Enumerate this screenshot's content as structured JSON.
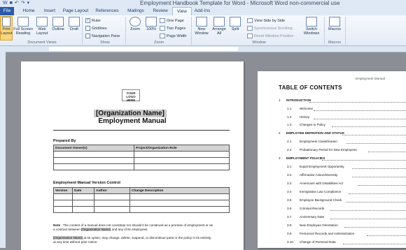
{
  "window": {
    "title": "Employment Handbook Template for Word  -  Microsoft Word non-commercial use"
  },
  "tabs": [
    "File",
    "Home",
    "Insert",
    "Page Layout",
    "References",
    "Mailings",
    "Review",
    "View",
    "Add-Ins"
  ],
  "ribbon": {
    "document_views": {
      "group_label": "Document Views",
      "buttons": [
        "Print Layout",
        "Full Screen Reading",
        "Web Layout",
        "Outline",
        "Draft"
      ]
    },
    "show": {
      "group_label": "Show",
      "ruler": "Ruler",
      "gridlines": "Gridlines",
      "navigation_pane": "Navigation Pane"
    },
    "zoom": {
      "group_label": "Zoom",
      "zoom": "Zoom",
      "hundred": "100%",
      "one_page": "One Page",
      "two_pages": "Two Pages",
      "page_width": "Page Width"
    },
    "window": {
      "group_label": "Window",
      "new_window": "New Window",
      "arrange_all": "Arrange All",
      "split": "Split",
      "view_side_by_side": "View Side by Side",
      "sync_scrolling": "Synchronous Scrolling",
      "reset_window_position": "Reset Window Position",
      "switch_windows": "Switch Windows"
    },
    "macros": {
      "group_label": "Macros",
      "macros": "Macros"
    }
  },
  "page1": {
    "logo": "YOUR LOGO HERE",
    "org_name": "[Organization Name]",
    "title": "Employment  Manual",
    "prepared_by": "Prepared By",
    "owners_table": {
      "headers": [
        "Document Owner(s)",
        "Project/Organization Role"
      ]
    },
    "version_control": "Employment Manual Version Control",
    "version_table": {
      "headers": [
        "Version",
        "Date",
        "Author",
        "Change Description"
      ]
    },
    "note_label": "Note",
    "note_text": "The content of a manual does not constitute nor should it be construed as a promise of employment or as a contract between",
    "note_org": "[Organization Name]",
    "note_tail": "and any of its employees.",
    "note2_org": "[Organization Name]",
    "note2_text": "at its option, may change, delete, suspend, or discontinue parts or the policy in its entirety, at any time without prior notice."
  },
  "page2": {
    "running_head": "Employment Manual",
    "toc_title": "TABLE OF CONTENTS",
    "entries": [
      {
        "num": "1",
        "text": "INTRODUCTION",
        "level": 1
      },
      {
        "num": "1.1",
        "text": "Welcome",
        "level": 2
      },
      {
        "num": "1.2",
        "text": "History",
        "level": 2
      },
      {
        "num": "1.3",
        "text": "Changes in Policy",
        "level": 2
      },
      {
        "num": "2",
        "text": "EMPLOYEE DEFINITION AND STATUS",
        "level": 1
      },
      {
        "num": "2.1",
        "text": "Employment Classification",
        "level": 2
      },
      {
        "num": "2.2",
        "text": "Probationary Period for New Employees",
        "level": 2
      },
      {
        "num": "3",
        "text": "EMPLOYMENT POLICIES",
        "level": 1
      },
      {
        "num": "3.1",
        "text": "Equal Employment Opportunity",
        "level": 2
      },
      {
        "num": "3.2",
        "text": "Affirmative Action/Diversity",
        "level": 2
      },
      {
        "num": "3.3",
        "text": "Americans with Disabilities Act",
        "level": 2
      },
      {
        "num": "3.4",
        "text": "Immigration Law Compliance",
        "level": 2
      },
      {
        "num": "3.5",
        "text": "Employee Background Check",
        "level": 2
      },
      {
        "num": "3.6",
        "text": "Criminal Records",
        "level": 2
      },
      {
        "num": "3.7",
        "text": "Anniversary Date",
        "level": 2
      },
      {
        "num": "3.8",
        "text": "New Employee Orientation",
        "level": 2
      },
      {
        "num": "3.9",
        "text": "Personnel Records and Administration",
        "level": 2
      },
      {
        "num": "3.10",
        "text": "Change of Personal Data",
        "level": 2
      }
    ]
  }
}
